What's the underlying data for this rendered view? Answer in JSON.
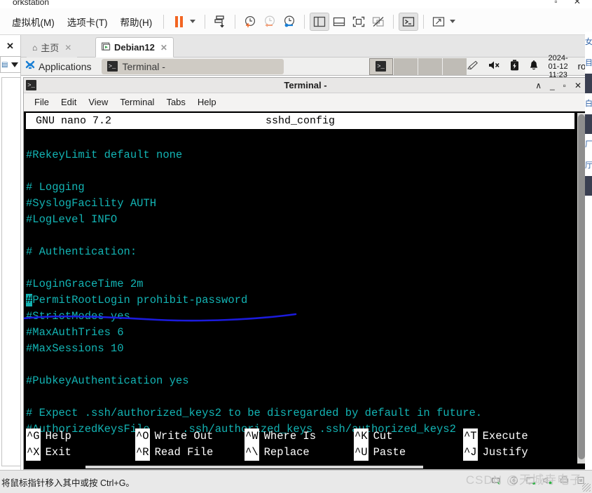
{
  "vmware": {
    "window_title": "orkstation",
    "window_buttons": [
      "▫",
      "✕"
    ],
    "menu": [
      {
        "label": "虚拟机(M)",
        "name": "menu-virtual-machine"
      },
      {
        "label": "选项卡(T)",
        "name": "menu-tabs"
      },
      {
        "label": "帮助(H)",
        "name": "menu-help"
      }
    ],
    "toolbar": [
      {
        "name": "pause-button",
        "icon": "pause-icon",
        "title": "暂停"
      },
      {
        "name": "pause-dropdown",
        "icon": "chevron-down-icon"
      },
      {
        "name": "send-ctrl-alt-del-button",
        "icon": "snapshot-download-icon"
      },
      {
        "name": "take-snapshot-button",
        "icon": "clock-plus-icon"
      },
      {
        "name": "revert-snapshot-button",
        "icon": "clock-back-icon"
      },
      {
        "name": "snapshot-manager-button",
        "icon": "clock-wrench-icon"
      },
      {
        "name": "show-library-button",
        "icon": "panel-left-icon"
      },
      {
        "name": "show-thumbnail-bar-button",
        "icon": "panel-bottom-icon"
      },
      {
        "name": "fullscreen-button",
        "icon": "fullscreen-icon"
      },
      {
        "name": "unity-mode-button",
        "icon": "unity-disabled-icon"
      },
      {
        "name": "console-view-button",
        "icon": "terminal-prompt-icon"
      },
      {
        "name": "stretch-guest-button",
        "icon": "expand-arrows-icon"
      },
      {
        "name": "stretch-dropdown",
        "icon": "chevron-down-icon"
      }
    ],
    "library": {
      "close_label": "✕",
      "dropdown_caret": "▼"
    },
    "tabs": [
      {
        "label": "主页",
        "name": "tab-home",
        "icon": "home-icon",
        "close": "✕",
        "active": false
      },
      {
        "label": "Debian12",
        "name": "tab-debian12",
        "icon": "vm-play-icon",
        "close": "✕",
        "active": true
      }
    ]
  },
  "guest_panel": {
    "applications_label": "Applications",
    "applications_icon": "xfce-mouse-icon",
    "window_button": {
      "label": "Terminal -",
      "icon": "terminal-icon"
    },
    "workspaces": [
      "",
      "",
      "",
      ""
    ],
    "current_workspace_icon": "terminal-icon",
    "tray": [
      {
        "name": "clipman-icon",
        "glyph": "✎"
      },
      {
        "name": "volume-muted-icon",
        "glyph": "🔇"
      },
      {
        "name": "battery-icon",
        "glyph": "🔋"
      },
      {
        "name": "notification-bell-icon",
        "glyph": "🔔"
      }
    ],
    "clock": {
      "date": "2024-01-12",
      "time": "11:23"
    },
    "user": "root"
  },
  "terminal_window": {
    "title": "Terminal -",
    "icon": "terminal-icon",
    "window_buttons": [
      {
        "name": "shade-button",
        "glyph": "∧"
      },
      {
        "name": "minimize-button",
        "glyph": "_"
      },
      {
        "name": "maximize-button",
        "glyph": "▫"
      },
      {
        "name": "close-button",
        "glyph": "✕"
      }
    ],
    "menu": [
      "File",
      "Edit",
      "View",
      "Terminal",
      "Tabs",
      "Help"
    ]
  },
  "nano": {
    "version_label": "GNU nano 7.2",
    "filename": "sshd_config",
    "lines": [
      {
        "text": "#RekeyLimit default none"
      },
      {
        "text": ""
      },
      {
        "text": "# Logging"
      },
      {
        "text": "#SyslogFacility AUTH"
      },
      {
        "text": "#LogLevel INFO"
      },
      {
        "text": ""
      },
      {
        "text": "# Authentication:"
      },
      {
        "text": ""
      },
      {
        "text": "#LoginGraceTime 2m"
      },
      {
        "text": "#PermitRootLogin prohibit-password",
        "cursor_col": 0
      },
      {
        "text": "#StrictModes yes"
      },
      {
        "text": "#MaxAuthTries 6"
      },
      {
        "text": "#MaxSessions 10"
      },
      {
        "text": ""
      },
      {
        "text": "#PubkeyAuthentication yes"
      },
      {
        "text": ""
      },
      {
        "text": "# Expect .ssh/authorized_keys2 to be disregarded by default in future."
      },
      {
        "text": "#AuthorizedKeysFile     .ssh/authorized_keys .ssh/authorized_keys2"
      }
    ],
    "shortcuts_row1": [
      {
        "key": "^G",
        "label": "Help"
      },
      {
        "key": "^O",
        "label": "Write Out"
      },
      {
        "key": "^W",
        "label": "Where Is"
      },
      {
        "key": "^K",
        "label": "Cut"
      },
      {
        "key": "^T",
        "label": "Execute"
      }
    ],
    "shortcuts_row2": [
      {
        "key": "^X",
        "label": "Exit"
      },
      {
        "key": "^R",
        "label": "Read File"
      },
      {
        "key": "^\\",
        "label": "Replace"
      },
      {
        "key": "^U",
        "label": "Paste"
      },
      {
        "key": "^J",
        "label": "Justify"
      }
    ],
    "colors": {
      "comment": "#13b4b4",
      "background": "#000000",
      "header_bg": "#ffffff",
      "header_fg": "#000000"
    }
  },
  "annotation": {
    "type": "hand-drawn-underline",
    "color": "#1b1bdc",
    "target_line": "#PermitRootLogin prohibit-password"
  },
  "statusbar": {
    "text": "将鼠标指针移入其中或按 Ctrl+G。",
    "icons": [
      {
        "name": "network-status-icon",
        "glyph": "🖧"
      },
      {
        "name": "cd-drive-icon",
        "glyph": "◎"
      },
      {
        "name": "floppy-icon",
        "glyph": "▤"
      },
      {
        "name": "sound-icon",
        "glyph": "◁"
      },
      {
        "name": "printer-icon",
        "glyph": "🖨"
      },
      {
        "name": "usb-icon",
        "glyph": "⬓"
      }
    ]
  },
  "watermark": "CSDN @天城寺电子"
}
